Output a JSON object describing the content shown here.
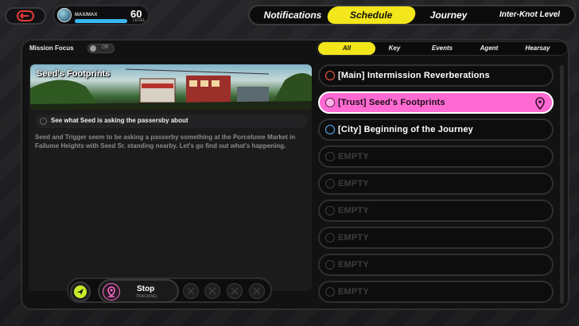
{
  "profile": {
    "xp_label": "MAX/MAX",
    "xp_progress": 1.0,
    "level": "60",
    "level_label": "LEVEL"
  },
  "top_tabs": [
    {
      "label": "Notifications",
      "active": false
    },
    {
      "label": "Schedule",
      "active": true
    },
    {
      "label": "Journey",
      "active": false
    },
    {
      "label": "Inter-Knot Level",
      "active": false
    }
  ],
  "mission_focus": {
    "label": "Mission Focus",
    "state": "Off"
  },
  "filters": [
    {
      "label": "All",
      "active": true
    },
    {
      "label": "Key",
      "active": false
    },
    {
      "label": "Events",
      "active": false
    },
    {
      "label": "Agent",
      "active": false
    },
    {
      "label": "Hearsay",
      "active": false
    }
  ],
  "detail": {
    "title": "Seed's Footprints",
    "objective": "See what Seed is asking the passersby about",
    "description": "Seed and Trigger seem to be asking a passerby something at the Porcelume Market in Failume Heights with Seed Sr. standing nearby. Let's go find out what's happening."
  },
  "tracking": {
    "label": "Stop",
    "sub": "TRACKING"
  },
  "missions": [
    {
      "label": "[Main] Intermission Reverberations",
      "type": "main",
      "active": false,
      "color": "#ff5a3c"
    },
    {
      "label": "[Trust] Seed's Footprints",
      "type": "trust",
      "active": true,
      "color": "#6a1a5a"
    },
    {
      "label": "[City] Beginning of the Journey",
      "type": "city",
      "active": false,
      "color": "#5ab4ff"
    },
    {
      "label": "EMPTY",
      "type": "empty"
    },
    {
      "label": "EMPTY",
      "type": "empty"
    },
    {
      "label": "EMPTY",
      "type": "empty"
    },
    {
      "label": "EMPTY",
      "type": "empty"
    },
    {
      "label": "EMPTY",
      "type": "empty"
    },
    {
      "label": "EMPTY",
      "type": "empty"
    }
  ],
  "colors": {
    "accent_yellow": "#f3e61a",
    "accent_pink": "#ff6ad2"
  }
}
